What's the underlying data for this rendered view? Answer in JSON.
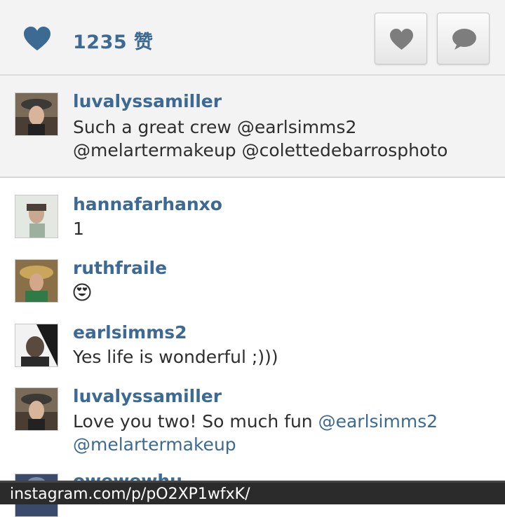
{
  "likes": {
    "count_label": "1235 赞"
  },
  "caption": {
    "username": "luvalyssamiller",
    "text_line1": "Such a great crew @earlsimms2",
    "text_line2": "@melartermakeup @colettedebarrosphoto"
  },
  "comments": [
    {
      "username": "hannafarhanxo",
      "text": "1"
    },
    {
      "username": "ruthfraile",
      "text": "",
      "emoji": "heart-eyes-emoji"
    },
    {
      "username": "earlsimms2",
      "text": "Yes life is wonderful ;)))"
    },
    {
      "username": "luvalyssamiller",
      "text": "Love you two! So much fun ",
      "mention1": "@earlsimms2",
      "mention2": "@melartermakeup"
    },
    {
      "username": "owewewhu"
    }
  ],
  "browser": {
    "url": "instagram.com/p/pO2XP1wfxK/"
  },
  "colors": {
    "accent": "#3d6a93",
    "panel_bg": "#f3f3f3",
    "text": "#2e2e2e",
    "url_bar_bg": "#2b2b2b"
  }
}
